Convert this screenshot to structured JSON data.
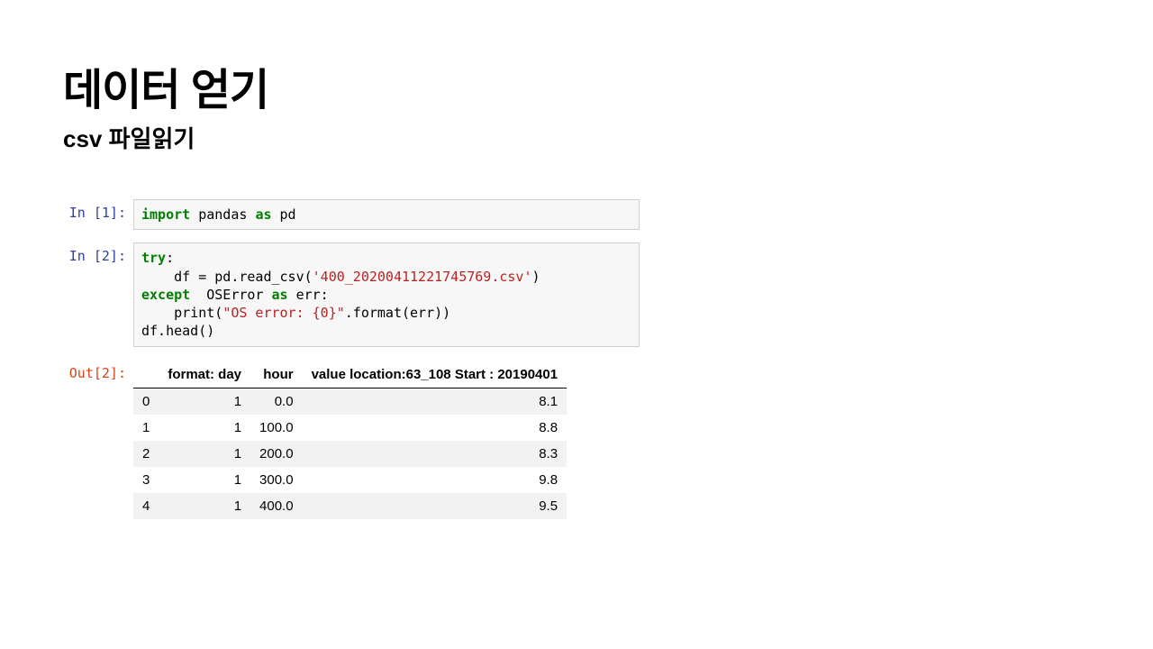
{
  "header": {
    "title": "데이터 얻기",
    "subtitle": "csv 파일읽기"
  },
  "cells": [
    {
      "prompt": "In [1]:",
      "prompt_class": "in",
      "type": "code",
      "tokens": [
        {
          "t": "import",
          "c": "kw-green"
        },
        {
          "t": " pandas ",
          "c": "kw-black"
        },
        {
          "t": "as",
          "c": "kw-green"
        },
        {
          "t": " pd",
          "c": "kw-black"
        }
      ]
    },
    {
      "prompt": "In [2]:",
      "prompt_class": "in",
      "type": "code",
      "tokens": [
        {
          "t": "try",
          "c": "kw-green"
        },
        {
          "t": ":\n    df ",
          "c": "kw-black"
        },
        {
          "t": "=",
          "c": "punct"
        },
        {
          "t": " pd.read_csv(",
          "c": "kw-black"
        },
        {
          "t": "'400_20200411221745769.csv'",
          "c": "str-red"
        },
        {
          "t": ")\n",
          "c": "kw-black"
        },
        {
          "t": "except",
          "c": "kw-green"
        },
        {
          "t": "  OSError ",
          "c": "kw-black"
        },
        {
          "t": "as",
          "c": "kw-green"
        },
        {
          "t": " err:\n    print(",
          "c": "kw-black"
        },
        {
          "t": "\"OS error: {0}\"",
          "c": "str-red"
        },
        {
          "t": ".format(err))\ndf.head()",
          "c": "kw-black"
        }
      ]
    },
    {
      "prompt": "Out[2]:",
      "prompt_class": "out",
      "type": "table",
      "table": {
        "columns": [
          "",
          "format: day",
          "hour",
          "value location:63_108 Start : 20190401"
        ],
        "rows": [
          [
            "0",
            "1",
            "0.0",
            "8.1"
          ],
          [
            "1",
            "1",
            "100.0",
            "8.8"
          ],
          [
            "2",
            "1",
            "200.0",
            "8.3"
          ],
          [
            "3",
            "1",
            "300.0",
            "9.8"
          ],
          [
            "4",
            "1",
            "400.0",
            "9.5"
          ]
        ]
      }
    }
  ]
}
